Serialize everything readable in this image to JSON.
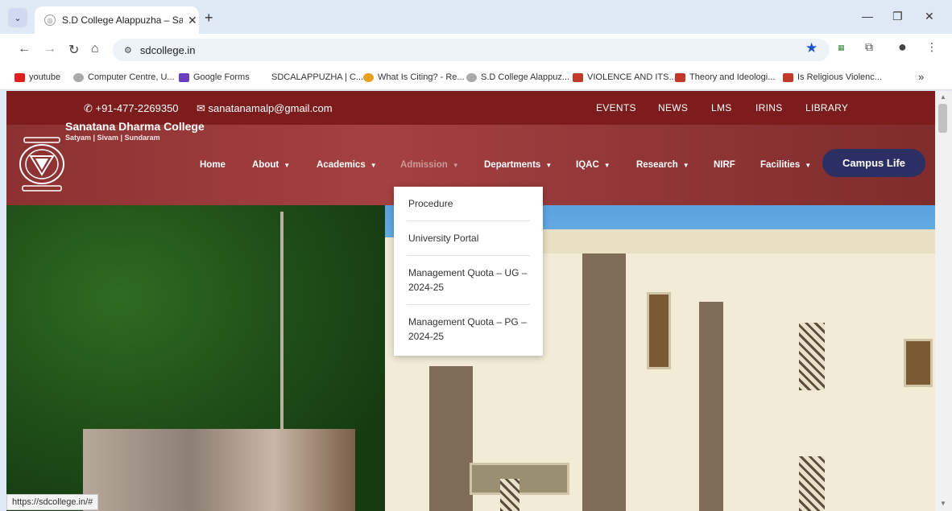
{
  "browser": {
    "tab_title": "S.D College Alappuzha – Satyam",
    "url": "sdcollege.in",
    "status_url": "https://sdcollege.in/#",
    "bookmarks": [
      {
        "label": "youtube",
        "color": "#e02020"
      },
      {
        "label": "Computer Centre, U...",
        "color": "#9a9a9a"
      },
      {
        "label": "Google Forms",
        "color": "#6a3fbf"
      },
      {
        "label": "SDCALAPPUZHA | C...",
        "color": ""
      },
      {
        "label": "What Is Citing? - Re...",
        "color": "#e8a020"
      },
      {
        "label": "S.D College Alappuz...",
        "color": "#9a9a9a"
      },
      {
        "label": "VIOLENCE AND ITS...",
        "color": "#c0392b"
      },
      {
        "label": "Theory and Ideologi...",
        "color": "#c0392b"
      },
      {
        "label": "Is Religious Violenc...",
        "color": "#c0392b"
      }
    ]
  },
  "site": {
    "phone": "+91-477-2269350",
    "email": "sanatanamalp@gmail.com",
    "top_links": [
      "EVENTS",
      "NEWS",
      "LMS",
      "IRINS",
      "LIBRARY"
    ],
    "college_name": "Sanatana Dharma College",
    "tagline": "Satyam | Sivam | Sundaram",
    "nav": {
      "home": "Home",
      "about": "About",
      "academics": "Academics",
      "admission": "Admission",
      "departments": "Departments",
      "iqac": "IQAC",
      "research": "Research",
      "nirf": "NIRF",
      "facilities": "Facilities"
    },
    "campus_life": "Campus Life",
    "admission_menu": [
      "Procedure",
      "University Portal",
      "Management Quota – UG – 2024-25",
      "Management Quota – PG – 2024-25"
    ]
  },
  "colors": {
    "topbar": "#7d1c1c",
    "header": "#9a3333",
    "campus_button": "#2c2f63",
    "bookmark_star": "#1a56c4"
  }
}
